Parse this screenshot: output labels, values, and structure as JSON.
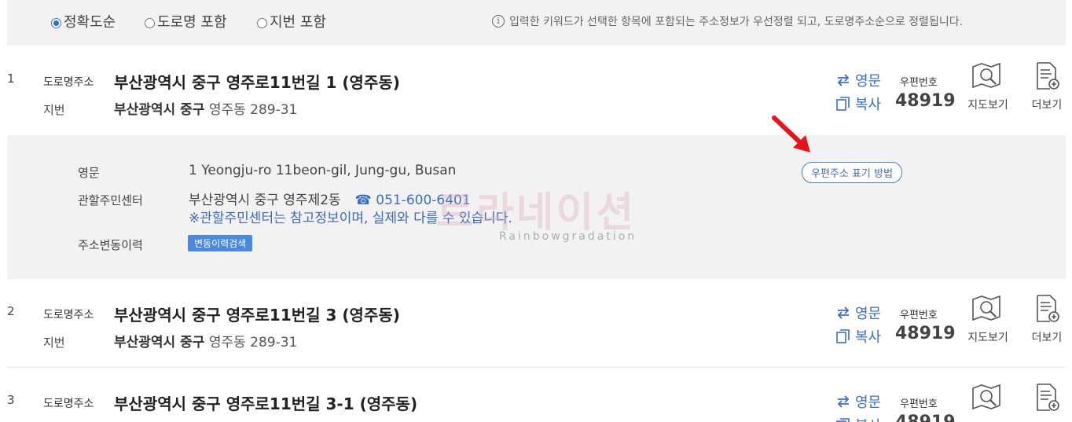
{
  "sort_options": [
    {
      "label": "정확도순",
      "selected": true
    },
    {
      "label": "도로명 포함",
      "selected": false
    },
    {
      "label": "지번 포함",
      "selected": false
    }
  ],
  "sort_info": "입력한 키워드가 선택한 항목에 포함되는 주소정보가 우선정렬 되고, 도로명주소순으로 정렬됩니다.",
  "labels": {
    "road": "도로명주소",
    "jibun": "지번",
    "english": "영문",
    "copy": "복사",
    "postcode": "우편번호",
    "map": "지도보기",
    "more": "더보기"
  },
  "results": [
    {
      "num": "1",
      "road": "부산광역시 중구 영주로11번길 1 (영주동)",
      "jibun_bold": "부산광역시 중구",
      "jibun_rest": "영주동 289-31",
      "postcode": "48919"
    },
    {
      "num": "2",
      "road": "부산광역시 중구 영주로11번길 3 (영주동)",
      "jibun_bold": "부산광역시 중구",
      "jibun_rest": "영주동 289-31",
      "postcode": "48919"
    },
    {
      "num": "3",
      "road": "부산광역시 중구 영주로11번길 3-1 (영주동)",
      "jibun_bold": "",
      "jibun_rest": "",
      "postcode": "48919"
    }
  ],
  "detail": {
    "english_label": "영문",
    "english_value": "1 Yeongju-ro 11beon-gil, Jung-gu, Busan",
    "center_label": "관할주민센터",
    "center_value": "부산광역시 중구 영주제2동",
    "tel": "051-600-6401",
    "note": "※관할주민센터는 참고정보이며, 실제와 다를 수 있습니다.",
    "history_label": "주소변동이력",
    "history_button": "변동이력검색",
    "post_method_button": "우편주소 표기 방법"
  },
  "watermark": {
    "main": "르라네이션",
    "sub": "Rainbowgradation"
  },
  "colors": {
    "accent": "#3a6fc4",
    "arrow": "#e8141b",
    "panel": "#f2f2f2"
  }
}
